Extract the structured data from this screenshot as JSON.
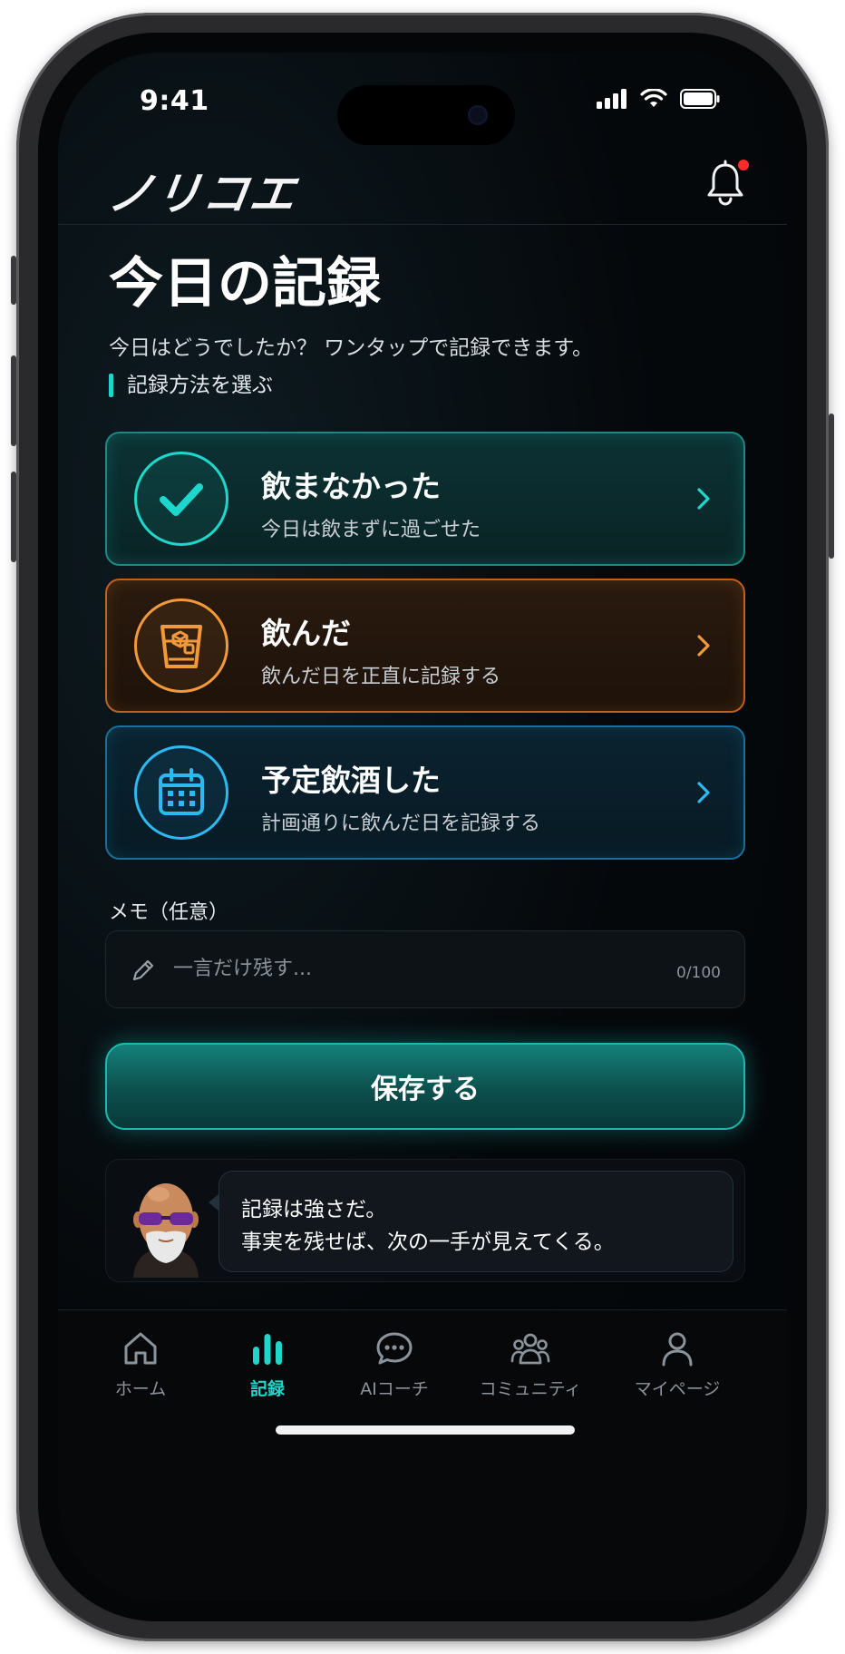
{
  "status_bar": {
    "time": "9:41"
  },
  "header": {
    "logo": "ノリコエ",
    "has_notification": true
  },
  "page": {
    "title": "今日の記録",
    "subtitle": "今日はどうでしたか？ ワンタップで記録できます。",
    "section_label": "記録方法を選ぶ"
  },
  "options": [
    {
      "title": "飲まなかった",
      "subtitle": "今日は飲まずに過ごせた",
      "icon": "check-icon",
      "color": "#1ed7cc"
    },
    {
      "title": "飲んだ",
      "subtitle": "飲んだ日を正直に記録する",
      "icon": "glass-icon",
      "color": "#f29a3a"
    },
    {
      "title": "予定飲酒した",
      "subtitle": "計画通りに飲んだ日を記録する",
      "icon": "calendar-icon",
      "color": "#2cb8f0"
    }
  ],
  "memo": {
    "label": "メモ（任意）",
    "placeholder": "一言だけ残す...",
    "value": "",
    "counter": "0/100"
  },
  "save_button": {
    "label": "保存する"
  },
  "coach": {
    "lines": [
      "記録は強さだ。",
      "事実を残せば、次の一手が見えてくる。"
    ]
  },
  "tabs": [
    {
      "label": "ホーム",
      "icon": "home-icon",
      "active": false
    },
    {
      "label": "記録",
      "icon": "bar-chart-icon",
      "active": true
    },
    {
      "label": "AIコーチ",
      "icon": "chat-icon",
      "active": false
    },
    {
      "label": "コミュニティ",
      "icon": "people-icon",
      "active": false
    },
    {
      "label": "マイページ",
      "icon": "person-icon",
      "active": false
    }
  ],
  "colors": {
    "accent": "#1ed7cc",
    "warning": "#f29a3a",
    "info": "#2cb8f0",
    "notification": "#ff2a2a"
  }
}
